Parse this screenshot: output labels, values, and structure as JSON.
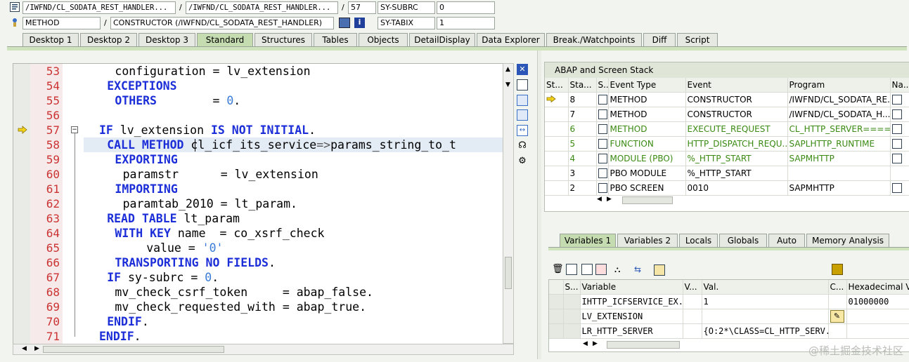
{
  "header": {
    "row1": {
      "program": "/IWFND/CL_SODATA_REST_HANDLER...",
      "include": "/IWFND/CL_SODATA_REST_HANDLER...",
      "line": "57",
      "sysfield_label": "SY-SUBRC",
      "sysfield_value": "0",
      "sep1": "/",
      "sep2": "/"
    },
    "row2": {
      "event_type": "METHOD",
      "event": "CONSTRUCTOR (/IWFND/CL_SODATA_REST_HANDLER)",
      "sysfield_label": "SY-TABIX",
      "sysfield_value": "1",
      "sep": "/"
    }
  },
  "tabs": [
    "Desktop 1",
    "Desktop 2",
    "Desktop 3",
    "Standard",
    "Structures",
    "Tables",
    "Objects",
    "DetailDisplay",
    "Data Explorer",
    "Break./Watchpoints",
    "Diff",
    "Script"
  ],
  "active_tab": "Standard",
  "code_lines": [
    {
      "n": "53",
      "text": "configuration = lv_extension"
    },
    {
      "n": "54",
      "text": "EXCEPTIONS"
    },
    {
      "n": "55",
      "text": "OTHERS        = 0."
    },
    {
      "n": "56",
      "text": ""
    },
    {
      "n": "57",
      "text": "IF lv_extension IS NOT INITIAL."
    },
    {
      "n": "58",
      "text": "CALL METHOD cl_icf_its_service=>params_string_to_t"
    },
    {
      "n": "59",
      "text": "EXPORTING"
    },
    {
      "n": "60",
      "text": "paramstr      = lv_extension"
    },
    {
      "n": "61",
      "text": "IMPORTING"
    },
    {
      "n": "62",
      "text": "paramtab_2010 = lt_param."
    },
    {
      "n": "63",
      "text": "READ TABLE lt_param"
    },
    {
      "n": "64",
      "text": "WITH KEY name  = co_xsrf_check"
    },
    {
      "n": "65",
      "text": "value = '0'"
    },
    {
      "n": "66",
      "text": "TRANSPORTING NO FIELDS."
    },
    {
      "n": "67",
      "text": "IF sy-subrc = 0."
    },
    {
      "n": "68",
      "text": "mv_check_csrf_token     = abap_false."
    },
    {
      "n": "69",
      "text": "mv_check_requested_with = abap_true."
    },
    {
      "n": "70",
      "text": "ENDIF."
    },
    {
      "n": "71",
      "text": "ENDIF."
    }
  ],
  "stack": {
    "title": "ABAP and Screen Stack",
    "columns": [
      "St...",
      "Sta...",
      "S...",
      "Event Type",
      "Event",
      "Program",
      "Na..."
    ],
    "rows": [
      {
        "level": "8",
        "type": "METHOD",
        "event": "CONSTRUCTOR",
        "program": "/IWFND/CL_SODATA_RE...",
        "current": true,
        "green": false
      },
      {
        "level": "7",
        "type": "METHOD",
        "event": "CONSTRUCTOR",
        "program": "/IWFND/CL_SODATA_H...",
        "current": false,
        "green": false
      },
      {
        "level": "6",
        "type": "METHOD",
        "event": "EXECUTE_REQUEST",
        "program": "CL_HTTP_SERVER=====...",
        "current": false,
        "green": true
      },
      {
        "level": "5",
        "type": "FUNCTION",
        "event": "HTTP_DISPATCH_REQU...",
        "program": "SAPLHTTP_RUNTIME",
        "current": false,
        "green": true
      },
      {
        "level": "4",
        "type": "MODULE (PBO)",
        "event": "%_HTTP_START",
        "program": "SAPMHTTP",
        "current": false,
        "green": true
      },
      {
        "level": "3",
        "type": "PBO MODULE",
        "event": "%_HTTP_START",
        "program": "",
        "current": false,
        "green": false
      },
      {
        "level": "2",
        "type": "PBO SCREEN",
        "event": "0010",
        "program": "SAPMHTTP",
        "current": false,
        "green": false
      }
    ]
  },
  "var_tabs": [
    "Variables 1",
    "Variables 2",
    "Locals",
    "Globals",
    "Auto",
    "Memory Analysis"
  ],
  "active_var_tab": "Variables 1",
  "variables": {
    "columns": [
      "S...",
      "Variable",
      "V...",
      "Val.",
      "C...",
      "Hexadecimal Val"
    ],
    "rows": [
      {
        "name": "IHTTP_ICFSERVICE_EX...",
        "value": "1",
        "hex": "01000000"
      },
      {
        "name": "LV_EXTENSION",
        "value": "",
        "hex": ""
      },
      {
        "name": "LR_HTTP_SERVER",
        "value": "{O:2*\\CLASS=CL_HTTP_SERV...",
        "hex": ""
      }
    ]
  },
  "watermark": "@稀土掘金技术社区",
  "colors": {
    "keyword": "#1c2ed8",
    "line_number": "#cc3333",
    "active_tab": "#c5dcb0",
    "green_row": "#3a8a12"
  }
}
